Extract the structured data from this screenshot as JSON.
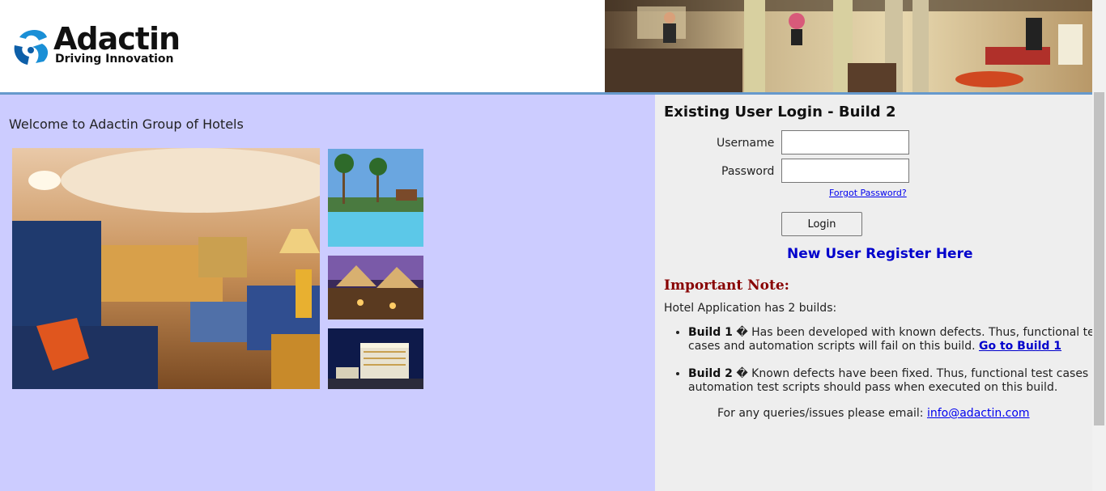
{
  "header": {
    "logo_name": "Adactin",
    "logo_tagline": "Driving Innovation"
  },
  "left": {
    "welcome": "Welcome to Adactin Group of Hotels"
  },
  "login": {
    "title": "Existing User Login - Build 2",
    "username_label": "Username",
    "password_label": "Password",
    "username_value": "",
    "password_value": "",
    "forgot_label": "Forgot Password?",
    "login_label": "Login",
    "register_label": "New User Register Here"
  },
  "note": {
    "heading": "Important Note:",
    "intro": "Hotel Application has 2 builds:",
    "build1_name": "Build 1",
    "build1_text": "� Has been developed with known defects. Thus, functional test cases and automation scripts will fail on this build. ",
    "build1_link": "Go to Build 1",
    "build2_name": "Build 2",
    "build2_text": "� Known defects have been fixed. Thus, functional test cases and automation test scripts should pass when executed on this build.",
    "queries_text": "For any queries/issues please email: ",
    "email": "info@adactin.com"
  },
  "colors": {
    "left_bg": "#ccccff",
    "right_bg": "#eeeeee",
    "header_rule": "#6699cc",
    "note_heading": "#880000",
    "link_blue": "#0000cc"
  },
  "icons": {
    "logo": "adactin-logo-icon"
  }
}
